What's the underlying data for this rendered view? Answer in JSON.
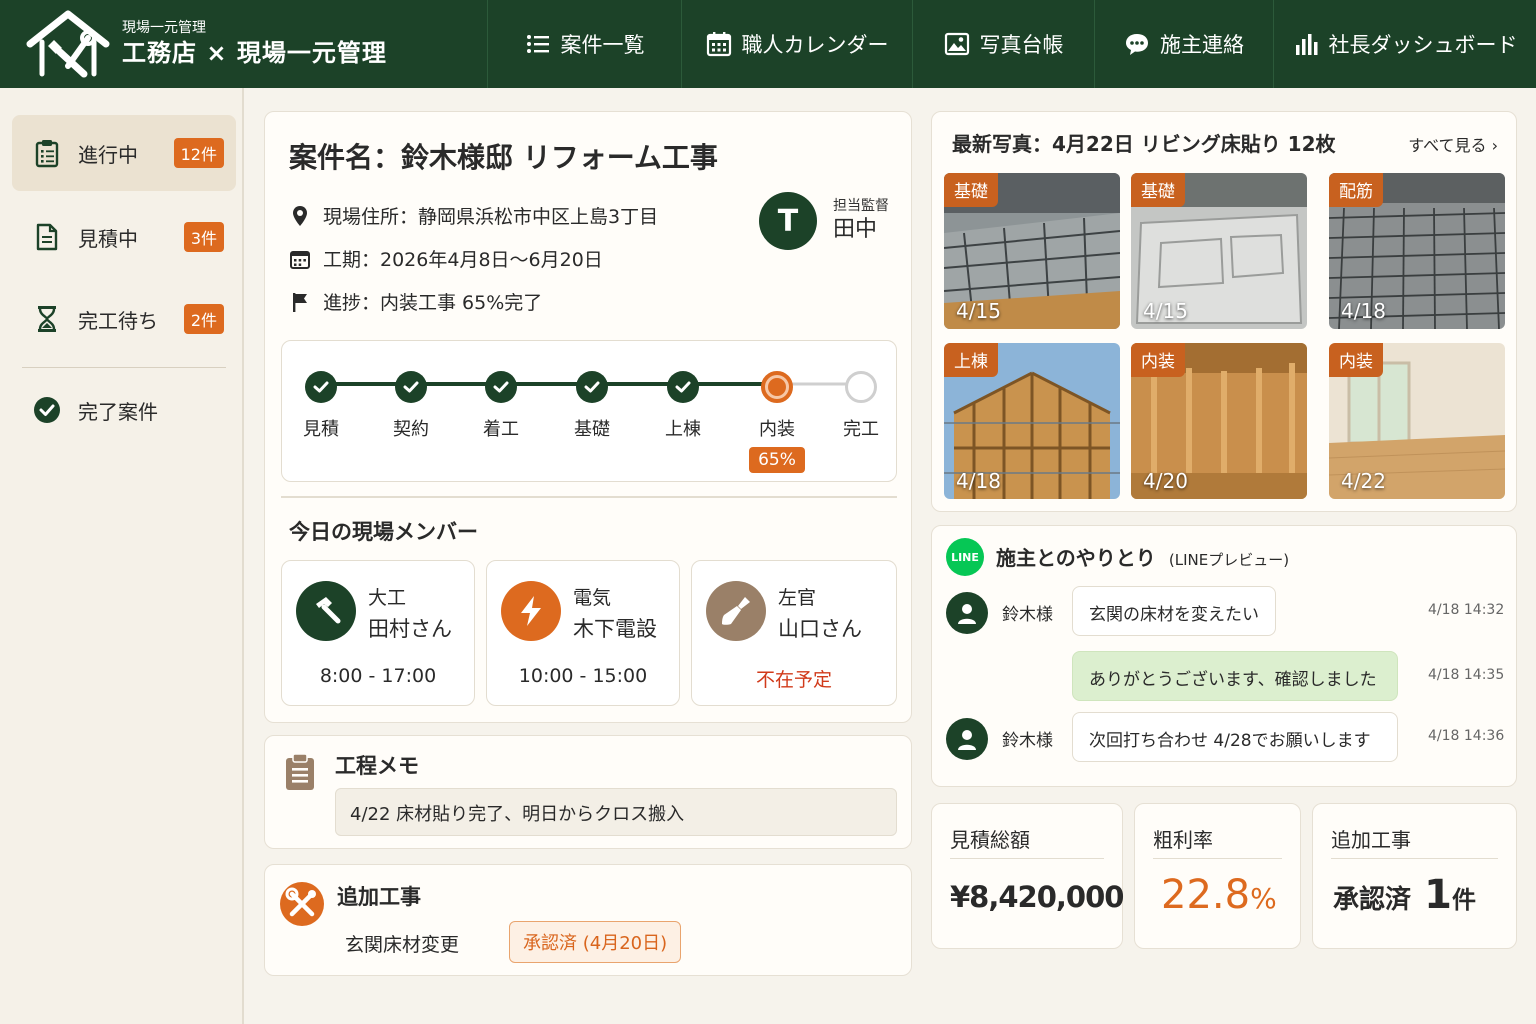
{
  "header": {
    "subtitle": "現場一元管理",
    "title": "工務店 × 現場一元管理",
    "nav": [
      {
        "label": "案件一覧",
        "icon": "list-icon"
      },
      {
        "label": "職人カレンダー",
        "icon": "calendar-icon"
      },
      {
        "label": "写真台帳",
        "icon": "photo-icon"
      },
      {
        "label": "施主連絡",
        "icon": "chat-icon"
      },
      {
        "label": "社長ダッシュボード",
        "icon": "bar-chart-icon"
      }
    ]
  },
  "sidebar": {
    "items": [
      {
        "label": "進行中",
        "count": "12件",
        "icon": "clipboard-icon"
      },
      {
        "label": "見積中",
        "count": "3件",
        "icon": "document-icon"
      },
      {
        "label": "完工待ち",
        "count": "2件",
        "icon": "hourglass-icon"
      },
      {
        "label": "完了案件",
        "icon": "check-circle-icon"
      }
    ]
  },
  "project": {
    "title": "案件名：鈴木様邸 リフォーム工事",
    "address": "現場住所：静岡県浜松市中区上島3丁目",
    "period": "工期：2026年4月8日〜6月20日",
    "progress": "進捗：内装工事 65%完了",
    "supervisor_label": "担当監督",
    "supervisor_initial": "T",
    "supervisor_name": "田中",
    "steps": [
      {
        "label": "見積",
        "state": "done"
      },
      {
        "label": "契約",
        "state": "done"
      },
      {
        "label": "着工",
        "state": "done"
      },
      {
        "label": "基礎",
        "state": "done"
      },
      {
        "label": "上棟",
        "state": "done"
      },
      {
        "label": "内装",
        "state": "current",
        "percent": "65%"
      },
      {
        "label": "完工",
        "state": "todo"
      }
    ]
  },
  "members": {
    "title": "今日の現場メンバー",
    "list": [
      {
        "role": "大工",
        "name": "田村さん",
        "time": "8:00 - 17:00",
        "icon": "hammer-icon",
        "color": "#1c4228"
      },
      {
        "role": "電気",
        "name": "木下電設",
        "time": "10:00 - 15:00",
        "icon": "lightning-icon",
        "color": "#dd6a1f"
      },
      {
        "role": "左官",
        "name": "山口さん",
        "time": "不在予定",
        "icon": "trowel-icon",
        "color": "#9a8068",
        "absent": true
      }
    ]
  },
  "memo": {
    "title": "工程メモ",
    "text": "4/22 床材貼り完了、明日からクロス搬入"
  },
  "additional": {
    "title": "追加工事",
    "item": "玄関床材変更",
    "status": "承認済 (4月20日)"
  },
  "photos": {
    "title": "最新写真：4月22日 リビング床貼り 12枚",
    "view_all": "すべて見る ›",
    "items": [
      {
        "tag": "基礎",
        "date": "4/15"
      },
      {
        "tag": "基礎",
        "date": "4/15"
      },
      {
        "tag": "配筋",
        "date": "4/18"
      },
      {
        "tag": "上棟",
        "date": "4/18"
      },
      {
        "tag": "内装",
        "date": "4/20"
      },
      {
        "tag": "内装",
        "date": "4/22"
      }
    ]
  },
  "chat": {
    "line_badge": "LINE",
    "title": "施主とのやりとり",
    "title_note": "(LINEプレビュー)",
    "messages": [
      {
        "sender": "鈴木様",
        "text": "玄関の床材を変えたい",
        "time": "4/18 14:32"
      },
      {
        "sender": "",
        "text": "ありがとうございます、確認しました",
        "time": "4/18 14:35"
      },
      {
        "sender": "鈴木様",
        "text": "次回打ち合わせ 4/28でお願いします",
        "time": "4/18 14:36"
      }
    ]
  },
  "kpi": {
    "estimate_label": "見積総額",
    "estimate_value": "¥8,420,000",
    "margin_label": "粗利率",
    "margin_value": "22.8",
    "margin_unit": "%",
    "add_label": "追加工事",
    "add_status": "承認済",
    "add_count": "1",
    "add_unit": "件"
  },
  "colors": {
    "primary": "#1c4228",
    "accent": "#dd6a1f",
    "line_green": "#06c755"
  }
}
